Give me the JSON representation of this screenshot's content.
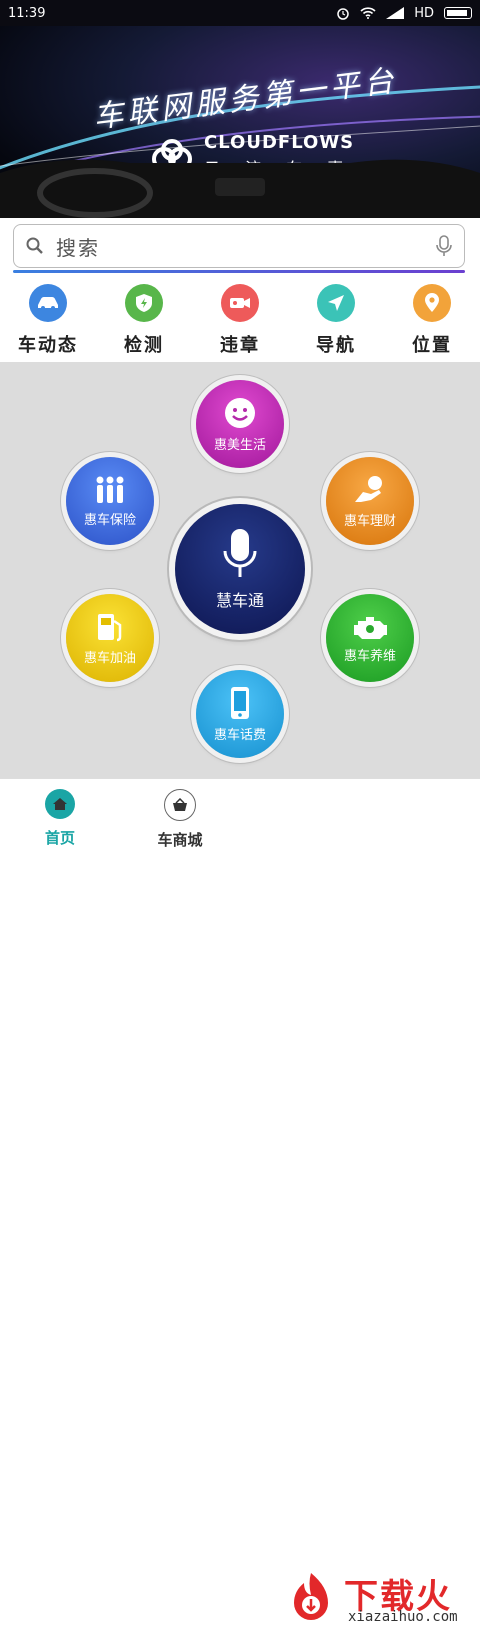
{
  "status_bar": {
    "time": "11:39",
    "network": "HD"
  },
  "banner": {
    "slogan": "车联网服务第一平台",
    "brand_en": "CLOUDFLOWS",
    "brand_cn": "云 流 车 惠"
  },
  "search": {
    "placeholder": "搜索"
  },
  "quick_actions": [
    {
      "label": "车动态",
      "icon": "car-icon",
      "color": "#3d86e0"
    },
    {
      "label": "检测",
      "icon": "shield-check-icon",
      "color": "#58b64a"
    },
    {
      "label": "违章",
      "icon": "camera-icon",
      "color": "#ee5a5a"
    },
    {
      "label": "导航",
      "icon": "navigation-arrow-icon",
      "color": "#3bc3b7"
    },
    {
      "label": "位置",
      "icon": "location-pin-icon",
      "color": "#f2a33a"
    }
  ],
  "hub": {
    "center": {
      "label": "慧车通",
      "icon": "microphone-icon"
    },
    "items": [
      {
        "label": "惠美生活",
        "icon": "smiley-icon",
        "color": "#c52ab5"
      },
      {
        "label": "惠车保险",
        "icon": "people-icon",
        "color": "#3f6fe0"
      },
      {
        "label": "惠车理财",
        "icon": "hand-coin-icon",
        "color": "#f08f1f"
      },
      {
        "label": "惠车加油",
        "icon": "fuel-pump-icon",
        "color": "#f0c800"
      },
      {
        "label": "惠车养维",
        "icon": "engine-icon",
        "color": "#2fae36"
      },
      {
        "label": "惠车话费",
        "icon": "phone-icon",
        "color": "#27a7e5"
      }
    ]
  },
  "tabbar": {
    "tabs": [
      {
        "label": "首页",
        "icon": "home-icon",
        "active": true,
        "color": "#1aa5a5"
      },
      {
        "label": "车商城",
        "icon": "basket-icon",
        "active": false,
        "color": "#333333"
      }
    ]
  },
  "watermark": {
    "name": "下载火",
    "url": "xiazaihuo.com"
  }
}
